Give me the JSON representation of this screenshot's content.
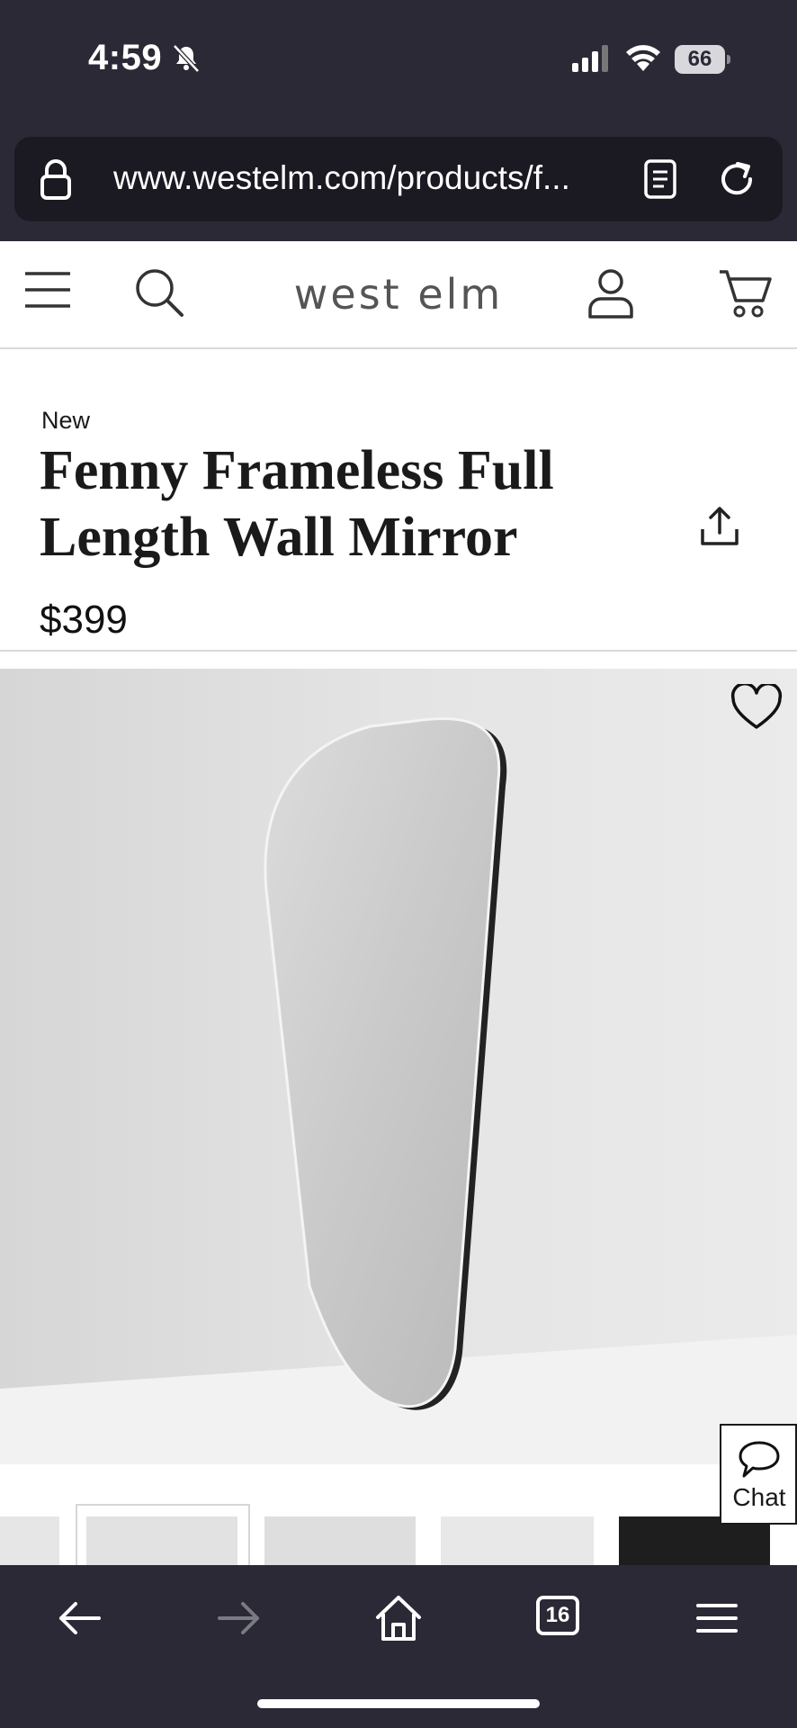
{
  "status_bar": {
    "time": "4:59",
    "battery": "66",
    "icons": [
      "bell-slash-icon",
      "cellular-signal-icon",
      "wifi-icon",
      "battery-icon"
    ]
  },
  "address_bar": {
    "url": "www.westelm.com/products/f...",
    "icons": [
      "lock-icon",
      "reader-icon",
      "reload-icon"
    ]
  },
  "header": {
    "logo": "west elm",
    "icons": [
      "hamburger-menu-icon",
      "search-icon",
      "account-icon",
      "cart-icon"
    ]
  },
  "product": {
    "badge": "New",
    "title": "Fenny Frameless Full Length Wall Mirror",
    "price": "$399",
    "icons": [
      "share-icon",
      "heart-icon"
    ]
  },
  "chat": {
    "label": "Chat",
    "icon": "chat-bubble-icon"
  },
  "toolbar": {
    "tabs_count": "16",
    "icons": [
      "back-arrow-icon",
      "forward-arrow-icon",
      "home-icon",
      "tabs-icon",
      "menu-icon"
    ]
  },
  "colors": {
    "chrome_dark": "#2a2935",
    "address_bar_bg": "#1b1a22",
    "text_primary": "#1a1a1a",
    "logo_gray": "#555555",
    "divider": "#d9d9d9"
  }
}
